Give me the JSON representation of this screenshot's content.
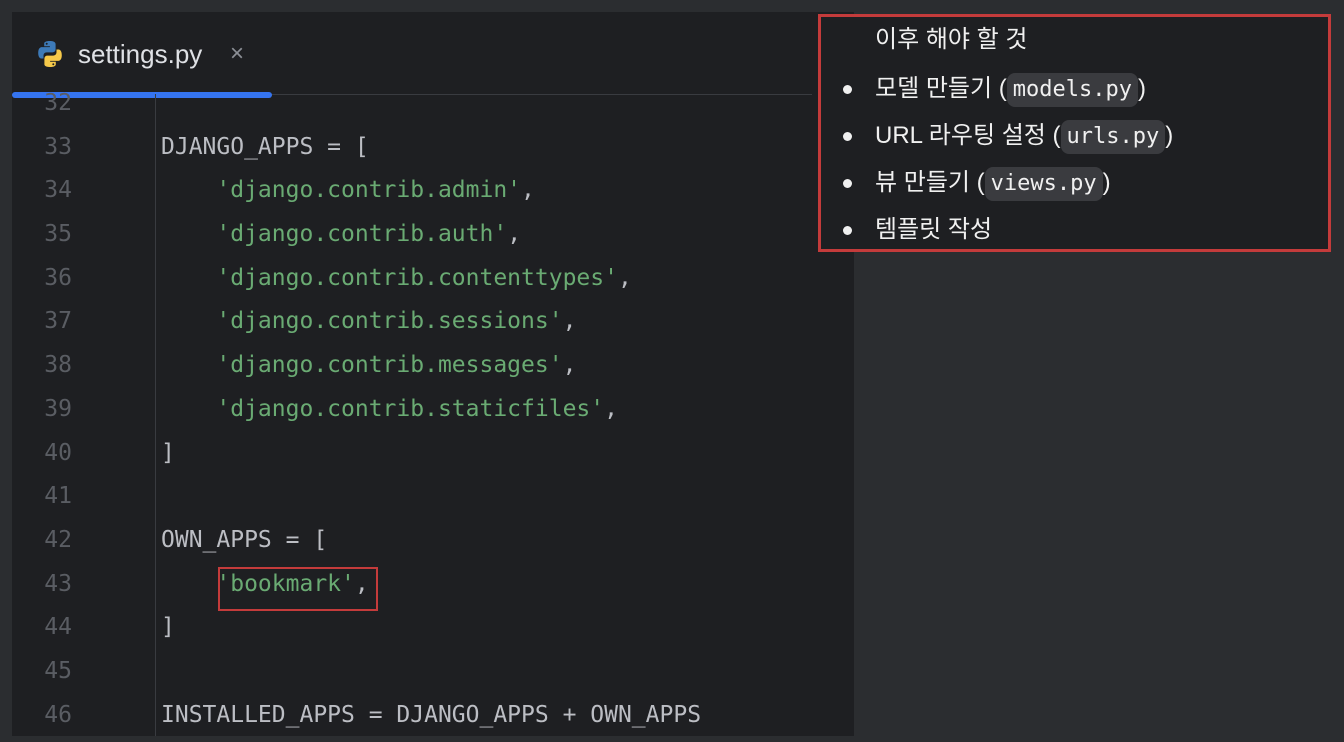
{
  "tab": {
    "filename": "settings.py",
    "close": "×",
    "icon": "python-icon"
  },
  "code_lines": [
    {
      "num": "32",
      "parts": []
    },
    {
      "num": "33",
      "parts": [
        {
          "t": "DJANGO_APPS = [",
          "c": "plain"
        }
      ]
    },
    {
      "num": "34",
      "parts": [
        {
          "t": "    ",
          "c": "plain"
        },
        {
          "t": "'django.contrib.admin'",
          "c": "str"
        },
        {
          "t": ",",
          "c": "plain"
        }
      ]
    },
    {
      "num": "35",
      "parts": [
        {
          "t": "    ",
          "c": "plain"
        },
        {
          "t": "'django.contrib.auth'",
          "c": "str"
        },
        {
          "t": ",",
          "c": "plain"
        }
      ]
    },
    {
      "num": "36",
      "parts": [
        {
          "t": "    ",
          "c": "plain"
        },
        {
          "t": "'django.contrib.contenttypes'",
          "c": "str"
        },
        {
          "t": ",",
          "c": "plain"
        }
      ]
    },
    {
      "num": "37",
      "parts": [
        {
          "t": "    ",
          "c": "plain"
        },
        {
          "t": "'django.contrib.sessions'",
          "c": "str"
        },
        {
          "t": ",",
          "c": "plain"
        }
      ]
    },
    {
      "num": "38",
      "parts": [
        {
          "t": "    ",
          "c": "plain"
        },
        {
          "t": "'django.contrib.messages'",
          "c": "str"
        },
        {
          "t": ",",
          "c": "plain"
        }
      ]
    },
    {
      "num": "39",
      "parts": [
        {
          "t": "    ",
          "c": "plain"
        },
        {
          "t": "'django.contrib.staticfiles'",
          "c": "str"
        },
        {
          "t": ",",
          "c": "plain"
        }
      ]
    },
    {
      "num": "40",
      "parts": [
        {
          "t": "]",
          "c": "plain"
        }
      ]
    },
    {
      "num": "41",
      "parts": []
    },
    {
      "num": "42",
      "parts": [
        {
          "t": "OWN_APPS = [",
          "c": "plain"
        }
      ]
    },
    {
      "num": "43",
      "parts": [
        {
          "t": "    ",
          "c": "plain"
        },
        {
          "t": "'bookmark'",
          "c": "str"
        },
        {
          "t": ",",
          "c": "plain"
        }
      ],
      "highlight": true
    },
    {
      "num": "44",
      "parts": [
        {
          "t": "]",
          "c": "plain"
        }
      ]
    },
    {
      "num": "45",
      "parts": []
    },
    {
      "num": "46",
      "parts": [
        {
          "t": "INSTALLED_APPS = DJANGO_APPS + OWN_APPS",
          "c": "plain"
        }
      ]
    }
  ],
  "note": {
    "title": "이후  해야 할 것",
    "items": [
      {
        "text": "모델 만들기 (",
        "code": "models.py",
        "suffix": ")"
      },
      {
        "text": "URL 라우팅 설정 (",
        "code": "urls.py",
        "suffix": ")"
      },
      {
        "text": "뷰 만들기 (",
        "code": "views.py",
        "suffix": ")"
      },
      {
        "text": "템플릿 작성",
        "code": "",
        "suffix": ""
      }
    ]
  },
  "colors": {
    "string": "#6aab73",
    "plain": "#bcbec4",
    "accent": "#3574f0",
    "highlight_border": "#c43b3b"
  }
}
